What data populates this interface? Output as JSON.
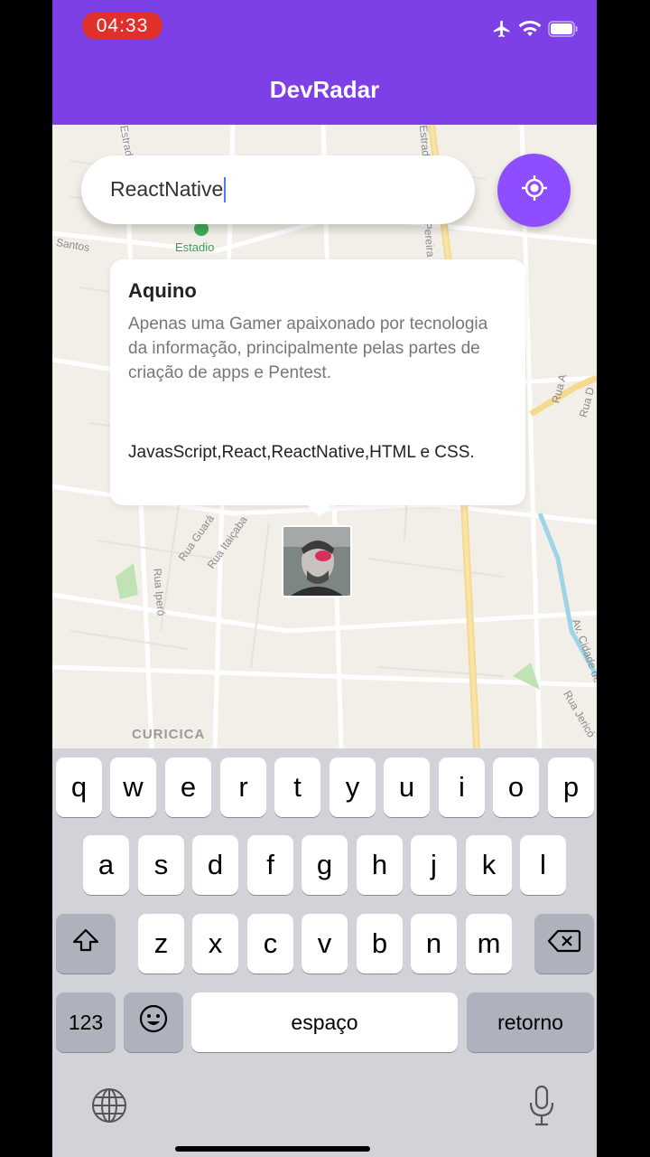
{
  "status_bar": {
    "time": "04:33"
  },
  "header": {
    "title": "DevRadar"
  },
  "search": {
    "value": "ReactNative"
  },
  "map": {
    "labels": [
      "Santos",
      "Estadio",
      "CURICICA",
      "Rua Guará",
      "Rua Itaiçaba",
      "Rua Iperó",
      "Rua A",
      "Rua D",
      "Av. Cidade de",
      "Rua Jericó",
      "Estrada",
      "Estrada",
      "Pereira"
    ]
  },
  "callout": {
    "name": "Aquino",
    "bio": "Apenas uma Gamer apaixonado por tecnologia da informação, principalmente pelas partes de criação de apps e Pentest.",
    "techs": "JavasScript,React,ReactNative,HTML e CSS."
  },
  "keyboard": {
    "row1": [
      "q",
      "w",
      "e",
      "r",
      "t",
      "y",
      "u",
      "i",
      "o",
      "p"
    ],
    "row2": [
      "a",
      "s",
      "d",
      "f",
      "g",
      "h",
      "j",
      "k",
      "l"
    ],
    "row3": [
      "z",
      "x",
      "c",
      "v",
      "b",
      "n",
      "m"
    ],
    "numbers_label": "123",
    "space_label": "espaço",
    "return_label": "retorno"
  },
  "icons": {
    "airplane": "airplane-icon",
    "wifi": "wifi-icon",
    "battery": "battery-icon",
    "locate": "locate-icon",
    "shift": "shift-icon",
    "backspace": "backspace-icon",
    "emoji": "emoji-icon",
    "globe": "globe-icon",
    "mic": "microphone-icon"
  },
  "colors": {
    "primary": "#7d40e7",
    "button": "#8e4dff",
    "time_pill": "#e0302b"
  }
}
